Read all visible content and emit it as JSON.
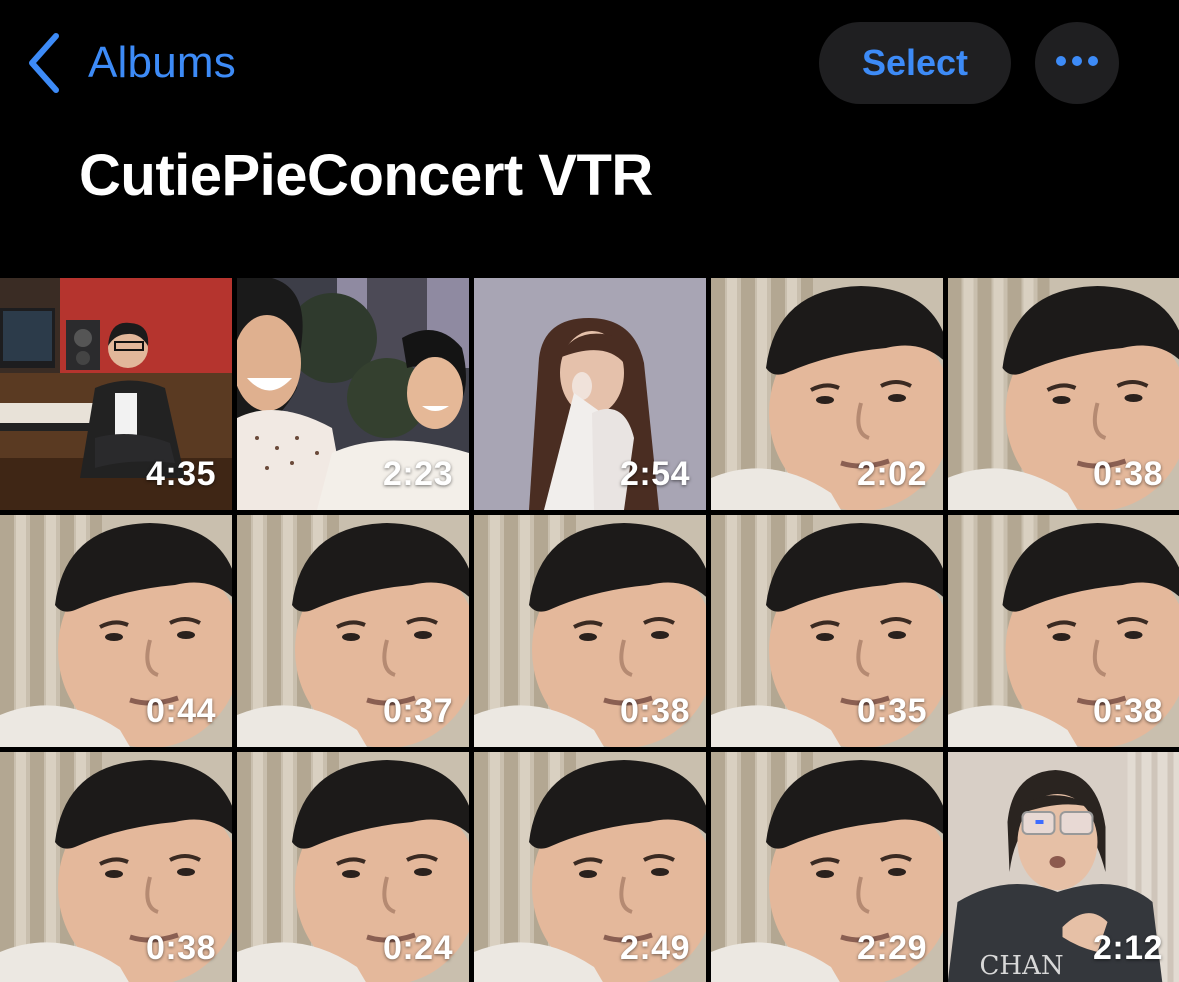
{
  "nav": {
    "back_label": "Albums",
    "select_label": "Select",
    "more_icon": "ellipsis-icon",
    "back_icon": "chevron-left-icon"
  },
  "album": {
    "title": "CutiePieConcert VTR"
  },
  "colors": {
    "accent": "#3d8bf7",
    "background": "#000000",
    "button_bg": "#1f1f21"
  },
  "videos": [
    {
      "duration": "4:35",
      "scene": "studio"
    },
    {
      "duration": "2:23",
      "scene": "selfie-two"
    },
    {
      "duration": "2:54",
      "scene": "woman-longhair"
    },
    {
      "duration": "2:02",
      "scene": "man-curtain"
    },
    {
      "duration": "0:38",
      "scene": "man-curtain"
    },
    {
      "duration": "0:44",
      "scene": "man-curtain"
    },
    {
      "duration": "0:37",
      "scene": "man-curtain"
    },
    {
      "duration": "0:38",
      "scene": "man-curtain"
    },
    {
      "duration": "0:35",
      "scene": "man-curtain"
    },
    {
      "duration": "0:38",
      "scene": "man-curtain"
    },
    {
      "duration": "0:38",
      "scene": "man-curtain"
    },
    {
      "duration": "0:24",
      "scene": "man-curtain"
    },
    {
      "duration": "2:49",
      "scene": "man-curtain"
    },
    {
      "duration": "2:29",
      "scene": "man-curtain"
    },
    {
      "duration": "2:12",
      "scene": "person-glasses"
    }
  ]
}
